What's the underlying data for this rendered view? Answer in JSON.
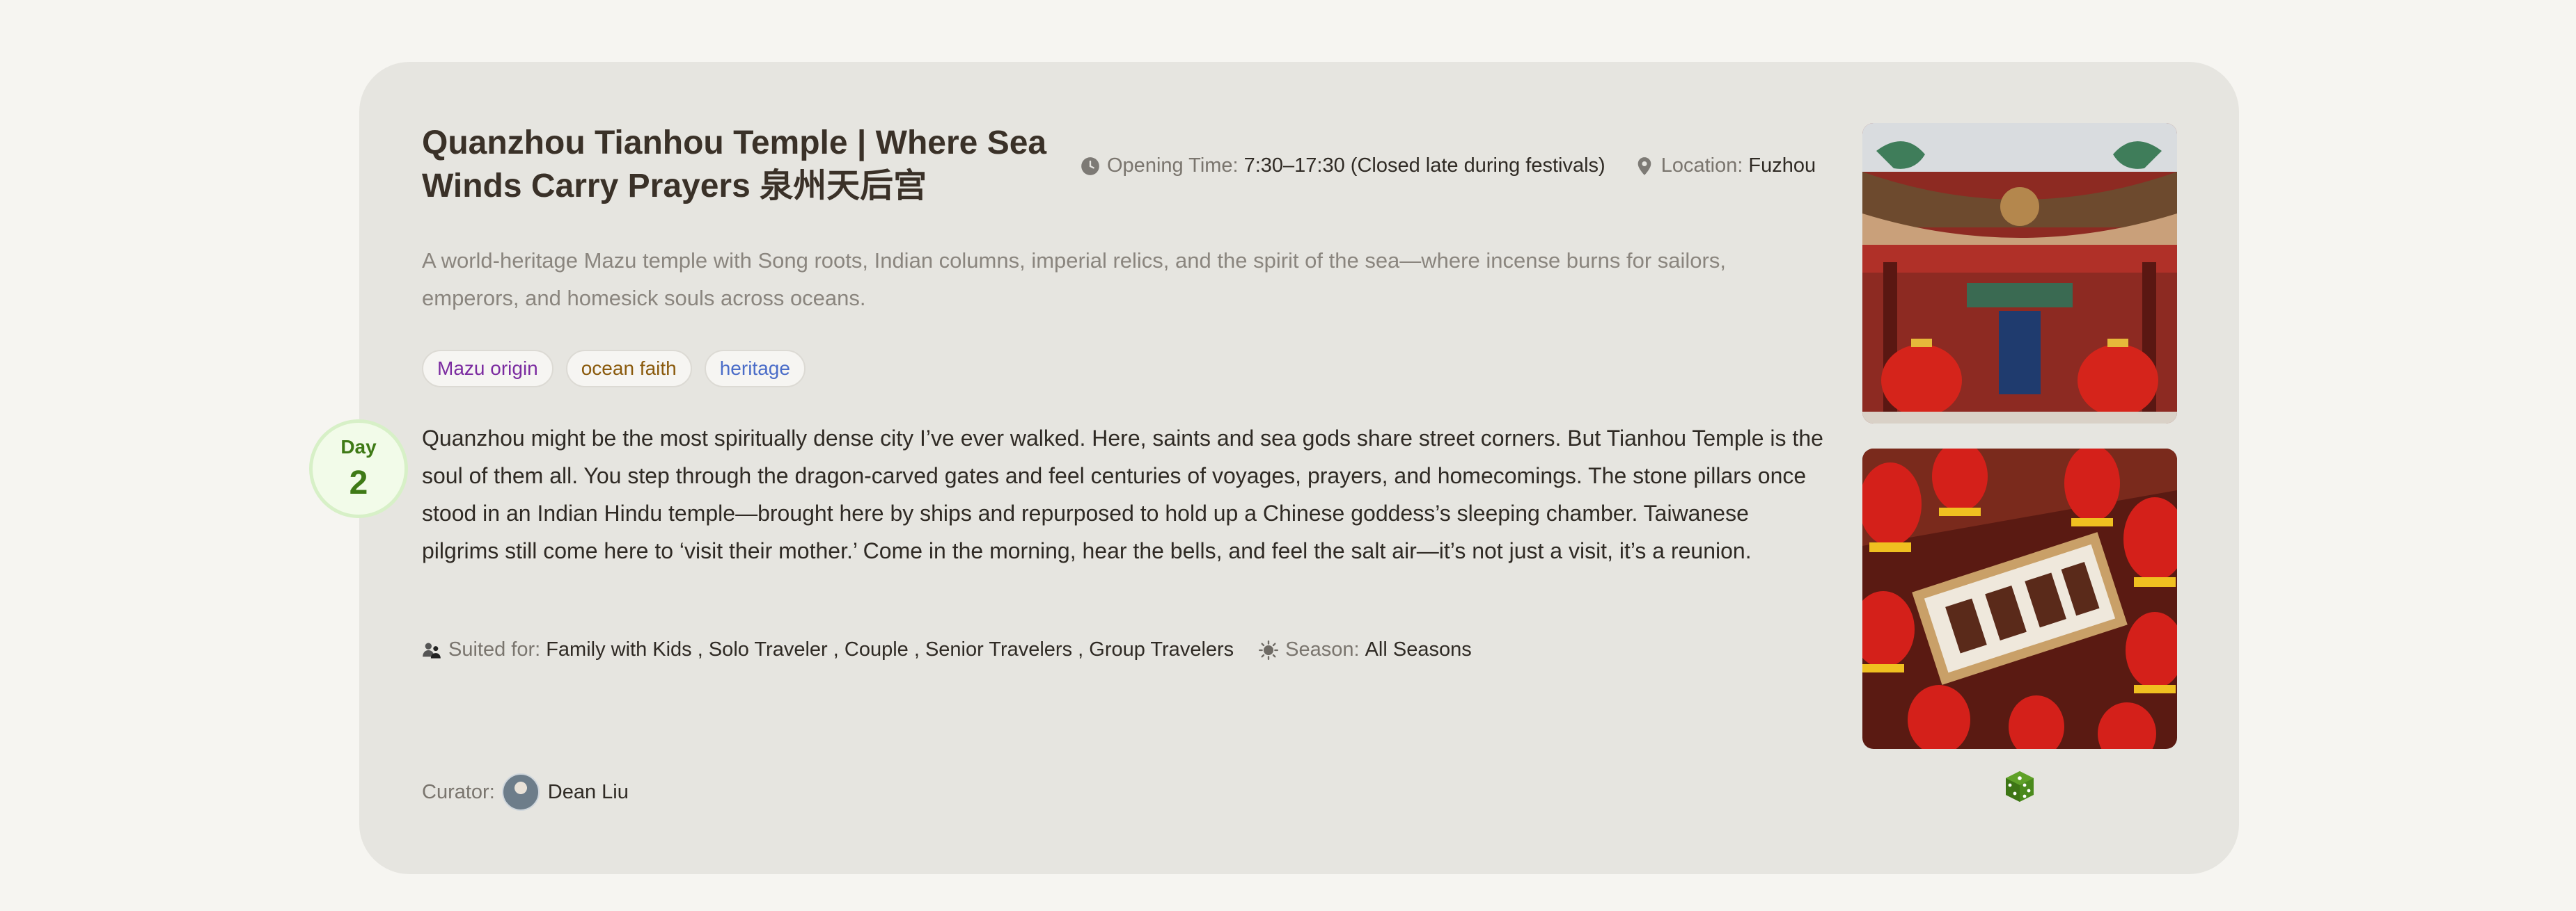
{
  "card": {
    "title": "Quanzhou Tianhou Temple | Where Sea Winds Carry Prayers 泉州天后宫",
    "opening_time_label": "Opening Time:",
    "opening_time_value": "7:30–17:30 (Closed late during festivals)",
    "location_label": "Location:",
    "location_value": "Fuzhou",
    "description": "A world-heritage Mazu temple with Song roots, Indian columns, imperial relics, and the spirit of the sea—where incense burns for sailors, emperors, and homesick souls across oceans.",
    "tags": [
      "Mazu origin",
      "ocean faith",
      "heritage"
    ],
    "day_label": "Day",
    "day_number": "2",
    "body": "Quanzhou might be the most spiritually dense city I’ve ever walked. Here, saints and sea gods share street corners. But Tianhou Temple is the soul of them all. You step through the dragon-carved gates and feel centuries of voyages, prayers, and homecomings. The stone pillars once stood in an Indian Hindu temple—brought here by ships and repurposed to hold up a Chinese goddess’s sleeping chamber. Taiwanese pilgrims still come here to ‘visit their mother.’ Come in the morning, hear the bells, and feel the salt air—it’s not just a visit, it’s a reunion.",
    "suited_label": "Suited for:",
    "suited_value": "Family with Kids , Solo Traveler , Couple , Senior Travelers , Group Travelers",
    "season_label": "Season:",
    "season_value": "All Seasons",
    "curator_label": "Curator:",
    "curator_name": "Dean Liu"
  },
  "icons": {
    "clock": "clock-icon",
    "location": "map-pin-icon",
    "people": "people-icon",
    "season": "sun-icon",
    "dice": "dice-icon"
  },
  "colors": {
    "accent_green": "#4a8a1c",
    "card_bg": "#e6e5e0",
    "page_bg": "#f6f5f1"
  }
}
